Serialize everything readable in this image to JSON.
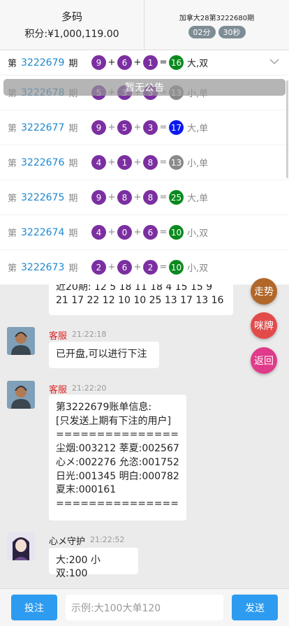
{
  "header": {
    "username": "多码",
    "points": "积分:¥1,000,119.00",
    "game_issue": "加拿大28第3222680期",
    "countdown_min": "02分",
    "countdown_sec": "30秒"
  },
  "draws": [
    {
      "prefix": "第",
      "issue": "3222679",
      "suffix": "期",
      "n1": "9",
      "n2": "6",
      "n3": "1",
      "sum": "16",
      "sum_color": "green",
      "result": "大,双"
    },
    {
      "prefix": "第",
      "issue": "3222678",
      "suffix": "期",
      "n1": "5",
      "n2": "3",
      "n3": "5",
      "sum": "13",
      "sum_color": "grey",
      "result": "小,单"
    },
    {
      "prefix": "第",
      "issue": "3222677",
      "suffix": "期",
      "n1": "9",
      "n2": "5",
      "n3": "3",
      "sum": "17",
      "sum_color": "blue",
      "result": "大,单"
    },
    {
      "prefix": "第",
      "issue": "3222676",
      "suffix": "期",
      "n1": "4",
      "n2": "1",
      "n3": "8",
      "sum": "13",
      "sum_color": "grey",
      "result": "小,单"
    },
    {
      "prefix": "第",
      "issue": "3222675",
      "suffix": "期",
      "n1": "9",
      "n2": "8",
      "n3": "8",
      "sum": "25",
      "sum_color": "green",
      "result": "大,单"
    },
    {
      "prefix": "第",
      "issue": "3222674",
      "suffix": "期",
      "n1": "4",
      "n2": "0",
      "n3": "6",
      "sum": "10",
      "sum_color": "green",
      "result": "小,双"
    },
    {
      "prefix": "第",
      "issue": "3222673",
      "suffix": "期",
      "n1": "2",
      "n2": "6",
      "n3": "2",
      "sum": "10",
      "sum_color": "green",
      "result": "小,双"
    }
  ],
  "symbols": {
    "plus": "+",
    "equals": "="
  },
  "notice": "暂无公告",
  "chat": {
    "partial_bubble_line1": "近20期: 12 5 18 11 18 4 15 15 9",
    "partial_bubble_line2": "21 17 22 12 10 10 25 13 17 13 16",
    "msg1": {
      "name": "客服",
      "time": "21:22:18",
      "text": "已开盘,可以进行下注"
    },
    "msg2": {
      "name": "客服",
      "time": "21:22:20",
      "lines": [
        "第3222679账单信息:",
        "[只发送上期有下注的用户]",
        "================",
        "尘烟:003212 莘夏:002567",
        "心メ:002276 允恣:001752",
        "日光:001345 明白:000782",
        "夏末:000161",
        "================"
      ]
    },
    "msg3": {
      "name": "心メ守护",
      "time": "21:22:52",
      "text": "大:200 小双:100"
    }
  },
  "fabs": {
    "trend": "走势",
    "road": "咪牌",
    "back": "返回"
  },
  "bottom": {
    "bet_button": "投注",
    "input_placeholder": "示例:大100大单120",
    "send_button": "发送"
  },
  "colors": {
    "accent_blue": "#2c9bf0",
    "issue_blue": "#1e88d0",
    "ball_purple": "#7b2fa0",
    "sum_green": "#0a8a1e",
    "sum_grey": "#8a8a8a",
    "sum_blue": "#0a1af0",
    "service_name": "#dd2222"
  }
}
